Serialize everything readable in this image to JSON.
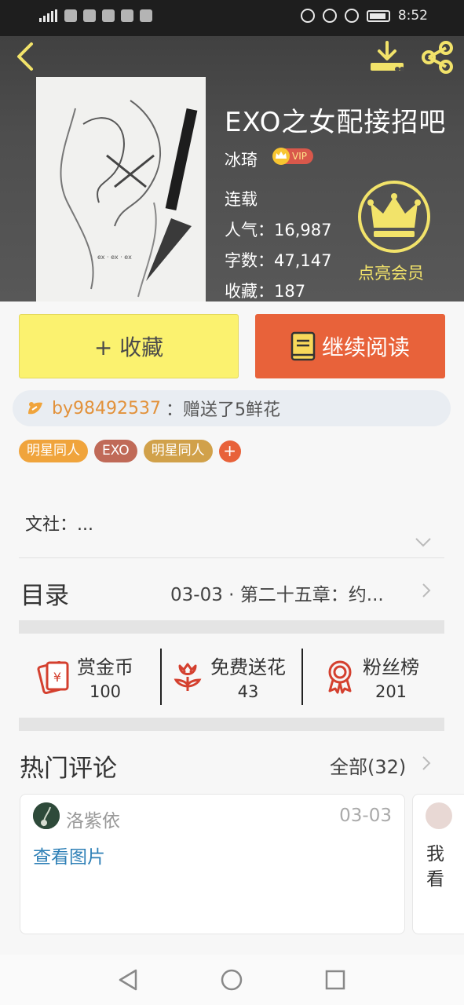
{
  "status_bar": {
    "time": "8:52",
    "network": "4G"
  },
  "book": {
    "title": "EXO之女配接招吧",
    "author": "冰琦",
    "vip_label": "VIP",
    "status": "连载",
    "popularity": "人气：16,987",
    "word_count": "字数：47,147",
    "favorites": "收藏：187"
  },
  "member": {
    "label": "点亮会员"
  },
  "actions": {
    "favorite_label": "+ 收藏",
    "read_label": "继续阅读"
  },
  "gift": {
    "user": "by98492537",
    "message": "：赠送了5鲜花"
  },
  "tags": [
    {
      "label": "明星同人",
      "color": "#f0a43c"
    },
    {
      "label": "EXO",
      "color": "#c06a58"
    },
    {
      "label": "明星同人",
      "color": "#d1a14a"
    }
  ],
  "tag_add": "+",
  "society": "文社：...",
  "toc": {
    "title": "目录",
    "latest": "03-03 · 第二十五章：约..."
  },
  "stats": [
    {
      "label": "赏金币",
      "count": "100",
      "icon": "red-envelope-icon"
    },
    {
      "label": "免费送花",
      "count": "43",
      "icon": "flower-icon"
    },
    {
      "label": "粉丝榜",
      "count": "201",
      "icon": "medal-icon"
    }
  ],
  "hot_comments": {
    "title": "热门评论",
    "all_label": "全部(32)",
    "items": [
      {
        "user": "洛紫依",
        "date": "03-03",
        "content": "查看图片"
      },
      {
        "content": "我看"
      }
    ]
  },
  "colors": {
    "accent_orange": "#e8623a",
    "accent_yellow": "#fbf26f",
    "crown_yellow": "#f2e36a"
  }
}
